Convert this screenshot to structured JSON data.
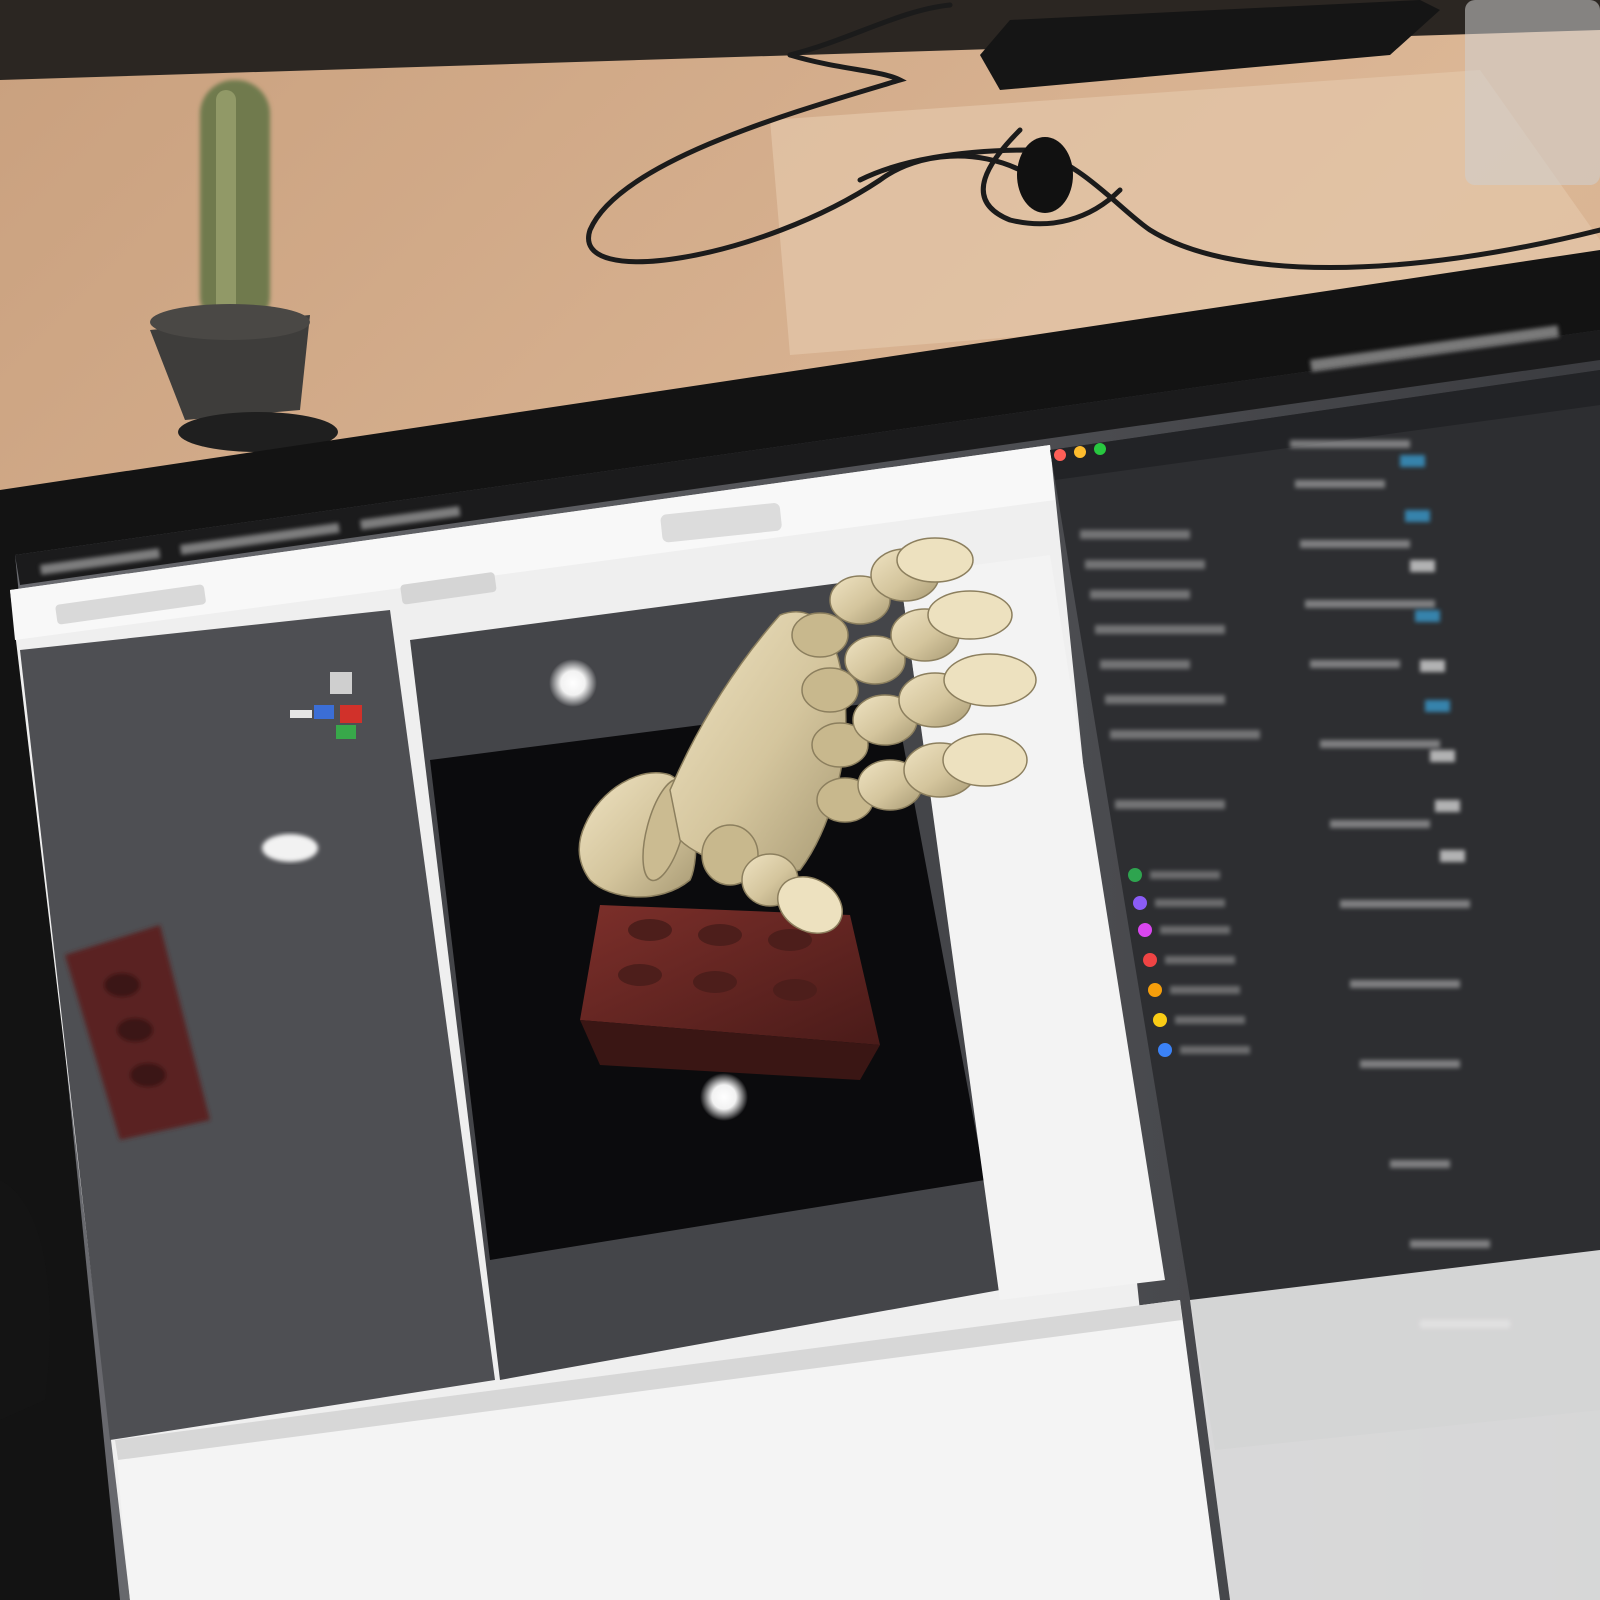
{
  "scene": {
    "objects": [
      "desk-surface",
      "cactus-plant",
      "cables",
      "black-device",
      "glass",
      "laptop",
      "ar-hand-model"
    ]
  },
  "laptop_screen": {
    "window_title": "",
    "viewport": {
      "content": [
        "brick-model",
        "light-source-top",
        "light-source-bottom",
        "ar-hand-overlay"
      ]
    },
    "right_panel_color_dots": [
      "#2ea44f",
      "#8b5cf6",
      "#d946ef",
      "#ef4444",
      "#f59e0b",
      "#facc15",
      "#3b82f6"
    ]
  },
  "colors": {
    "desk": "#d8b08c",
    "screen_bezel": "#141414",
    "viewport_bg": "#0a0a0a",
    "panel_dark": "#2a2a2c",
    "panel_mid": "#5b5c60",
    "hand": "#d7c9a3",
    "brick": "#6e2a26"
  }
}
